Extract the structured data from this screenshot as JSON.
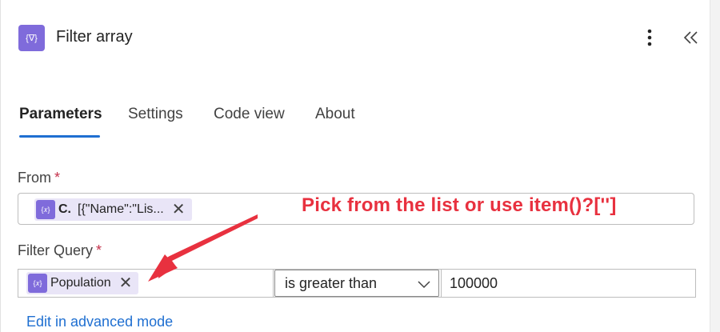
{
  "header": {
    "title": "Filter array",
    "icon": "curly-braces-filter-icon"
  },
  "tabs": [
    {
      "label": "Parameters",
      "active": true
    },
    {
      "label": "Settings",
      "active": false
    },
    {
      "label": "Code view",
      "active": false
    },
    {
      "label": "About",
      "active": false
    }
  ],
  "from": {
    "label": "From",
    "required_mark": "*",
    "token_name": "C.",
    "token_value": "[{\"Name\":\"Lis..."
  },
  "filter_query": {
    "label": "Filter Query",
    "required_mark": "*",
    "left_token": "Population",
    "operator": "is greater than",
    "value": "100000"
  },
  "edit_link": "Edit in advanced mode",
  "annotation": {
    "text": "Pick from the list or use item()?['']",
    "color": "#e8313f"
  },
  "colors": {
    "accent": "#1f6fd1",
    "icon_purple": "#7f6bdb",
    "token_bg": "#e9e5f7",
    "required": "#c4314b"
  }
}
